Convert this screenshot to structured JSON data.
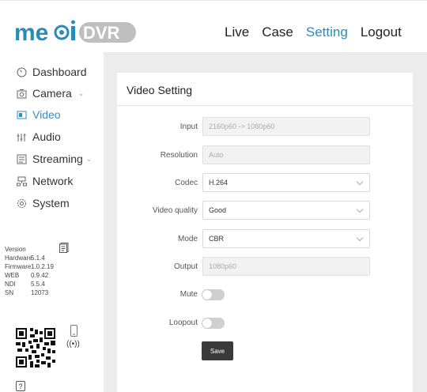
{
  "brand": {
    "logo_text_left": "me",
    "logo_text_dvr": "DVR",
    "logo_text": "mediDVR",
    "accent": "#2a8bb7"
  },
  "nav": {
    "items": [
      {
        "label": "Live"
      },
      {
        "label": "Case"
      },
      {
        "label": "Setting"
      },
      {
        "label": "Logout"
      }
    ],
    "active": "Setting"
  },
  "sidebar": {
    "items": [
      {
        "label": "Dashboard",
        "icon": "dashboard-icon"
      },
      {
        "label": "Camera",
        "icon": "camera-icon",
        "expandable": true
      },
      {
        "label": "Video",
        "icon": "video-icon",
        "active": true
      },
      {
        "label": "Audio",
        "icon": "audio-icon"
      },
      {
        "label": "Streaming",
        "icon": "streaming-icon",
        "expandable": true
      },
      {
        "label": "Network",
        "icon": "network-icon"
      },
      {
        "label": "System",
        "icon": "system-icon"
      }
    ],
    "info": [
      {
        "key": "Version",
        "value": ""
      },
      {
        "key": "Hardware",
        "value": "5.1.4"
      },
      {
        "key": "Firmware",
        "value": "1.0.2.19"
      },
      {
        "key": "WEB",
        "value": "0.9.42"
      },
      {
        "key": "NDI",
        "value": "5.5.4"
      },
      {
        "key": "SN",
        "value": "12073"
      }
    ],
    "help": "?"
  },
  "card": {
    "title": "Video Setting",
    "fields": {
      "input": {
        "label": "Input",
        "value": "2160p60 -> 1080p60"
      },
      "resolution": {
        "label": "Resolution",
        "value": "Auto"
      },
      "codec": {
        "label": "Codec",
        "value": "H.264"
      },
      "video_quality": {
        "label": "Video quality",
        "value": "Good"
      },
      "mode": {
        "label": "Mode",
        "value": "CBR"
      },
      "output": {
        "label": "Output",
        "value": "1080p60"
      },
      "mute": {
        "label": "Mute",
        "on": false
      },
      "loopout": {
        "label": "Loopout",
        "on": false
      }
    },
    "save_label": "Save"
  }
}
